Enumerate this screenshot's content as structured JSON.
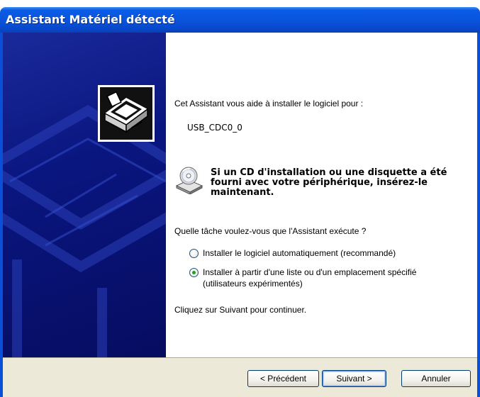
{
  "window": {
    "title": "Assistant Matériel détecté"
  },
  "content": {
    "intro": "Cet Assistant vous aide à installer le logiciel pour :",
    "device_name": "USB_CDC0_0",
    "cd_prompt_lines": [
      "Si un CD d'installation ou une disquette a été",
      "fourni avec votre périphérique, insérez-le",
      "maintenant."
    ],
    "question": "Quelle tâche voulez-vous que l'Assistant exécute ?",
    "options": [
      {
        "label": "Installer le logiciel automatiquement (recommandé)",
        "selected": false
      },
      {
        "label_lines": [
          "Installer à partir d'une liste ou d'un emplacement spécifié",
          "(utilisateurs expérimentés)"
        ],
        "selected": true
      }
    ],
    "continue_hint": "Cliquez sur Suivant pour continuer."
  },
  "buttons": {
    "back": "< Précédent",
    "next": "Suivant >",
    "cancel": "Annuler"
  },
  "icons": {
    "hardware": "hardware-drive-icon",
    "cd": "cd-drive-icon",
    "radio_unselected": "radio-unselected",
    "radio_selected": "radio-selected"
  },
  "colors": {
    "titlebar": "#0a54de",
    "side_panel": "#0a1680",
    "dialog_bar": "#ece9d8",
    "radio_dot": "#21a121"
  }
}
